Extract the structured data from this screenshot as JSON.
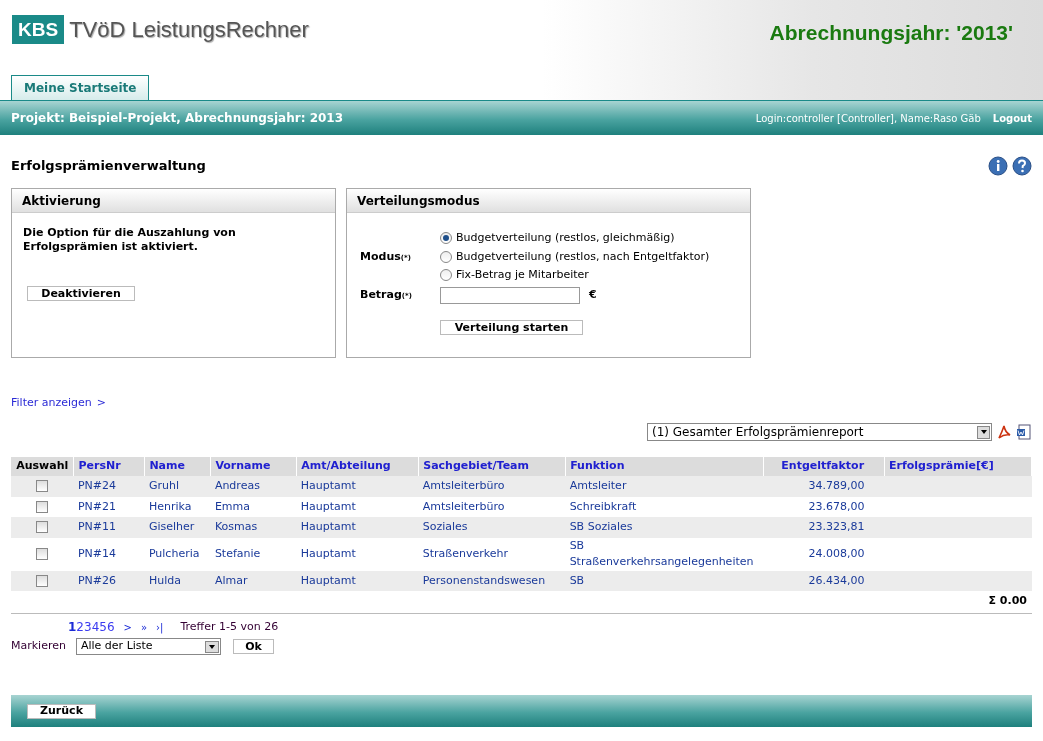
{
  "header": {
    "logo_badge": "KBS",
    "logo_text": "TVöD LeistungsRechner",
    "year_title": "Abrechnungsjahr: '2013'"
  },
  "tabs": [
    {
      "label": "Meine Startseite",
      "selected": true
    }
  ],
  "project_bar": {
    "project": "Projekt: Beispiel-Projekt, Abrechnungsjahr: 2013",
    "login": "Login:controller [Controller], Name:Raso Gäb",
    "logout": "Logout"
  },
  "page_title": "Erfolgsprämienverwaltung",
  "activation": {
    "title": "Aktivierung",
    "message": "Die Option für die Auszahlung von Erfolgsprämien ist aktiviert.",
    "button": "Deaktivieren"
  },
  "distribution": {
    "title": "Verteilungsmodus",
    "mode_label": "Modus",
    "mode_required": "(*)",
    "options": [
      {
        "label": "Budgetverteilung (restlos, gleichmäßig)",
        "selected": true
      },
      {
        "label": "Budgetverteilung (restlos, nach Entgeltfaktor)",
        "selected": false
      },
      {
        "label": "Fix-Betrag je Mitarbeiter",
        "selected": false
      }
    ],
    "amount_label": "Betrag",
    "amount_required": "(*)",
    "currency": "€",
    "button": "Verteilung starten"
  },
  "filter_link": "Filter anzeigen",
  "filter_arrow": ">",
  "report_select": "(1) Gesamter Erfolgsprämienreport",
  "table": {
    "columns": [
      "Auswahl",
      "PersNr",
      "Name",
      "Vorname",
      "Amt/Abteilung",
      "Sachgebiet/Team",
      "Funktion",
      "Entgeltfaktor",
      "Erfolgsprämie[€]"
    ],
    "rows": [
      {
        "checked": false,
        "cells": [
          "",
          "PN#24",
          "Gruhl",
          "Andreas",
          "Hauptamt",
          "Amtsleiterbüro",
          "Amtsleiter",
          "34.789,00"
        ]
      },
      {
        "checked": false,
        "cells": [
          "",
          "PN#21",
          "Henrika",
          "Emma",
          "Hauptamt",
          "Amtsleiterbüro",
          "Schreibkraft",
          "23.678,00"
        ]
      },
      {
        "checked": false,
        "cells": [
          "",
          "PN#11",
          "Giselher",
          "Kosmas",
          "Hauptamt",
          "Soziales",
          "SB Soziales",
          "23.323,81"
        ]
      },
      {
        "checked": false,
        "cells": [
          "",
          "PN#14",
          "Pulcheria",
          "Stefanie",
          "Hauptamt",
          "Straßenverkehr",
          "SB Straßenverkehrsangelegenheiten",
          "24.008,00"
        ]
      },
      {
        "checked": false,
        "cells": [
          "",
          "PN#26",
          "Hulda",
          "Almar",
          "Hauptamt",
          "Personenstandswesen",
          "SB",
          "26.434,00"
        ]
      }
    ],
    "sum": "Σ 0.00"
  },
  "pagination": {
    "pages": [
      {
        "label": "1",
        "selected": true
      },
      {
        "label": "2",
        "selected": false
      },
      {
        "label": "3",
        "selected": false
      },
      {
        "label": "4",
        "selected": false
      },
      {
        "label": "5",
        "selected": false
      },
      {
        "label": "6",
        "selected": false
      }
    ],
    "nav": [
      ">",
      "»",
      "›|"
    ],
    "hits": "Treffer 1-5 von 26"
  },
  "mark": {
    "label": "Markieren",
    "select": "Alle der Liste",
    "button": "Ok"
  },
  "footer": {
    "button": "Zurück"
  }
}
